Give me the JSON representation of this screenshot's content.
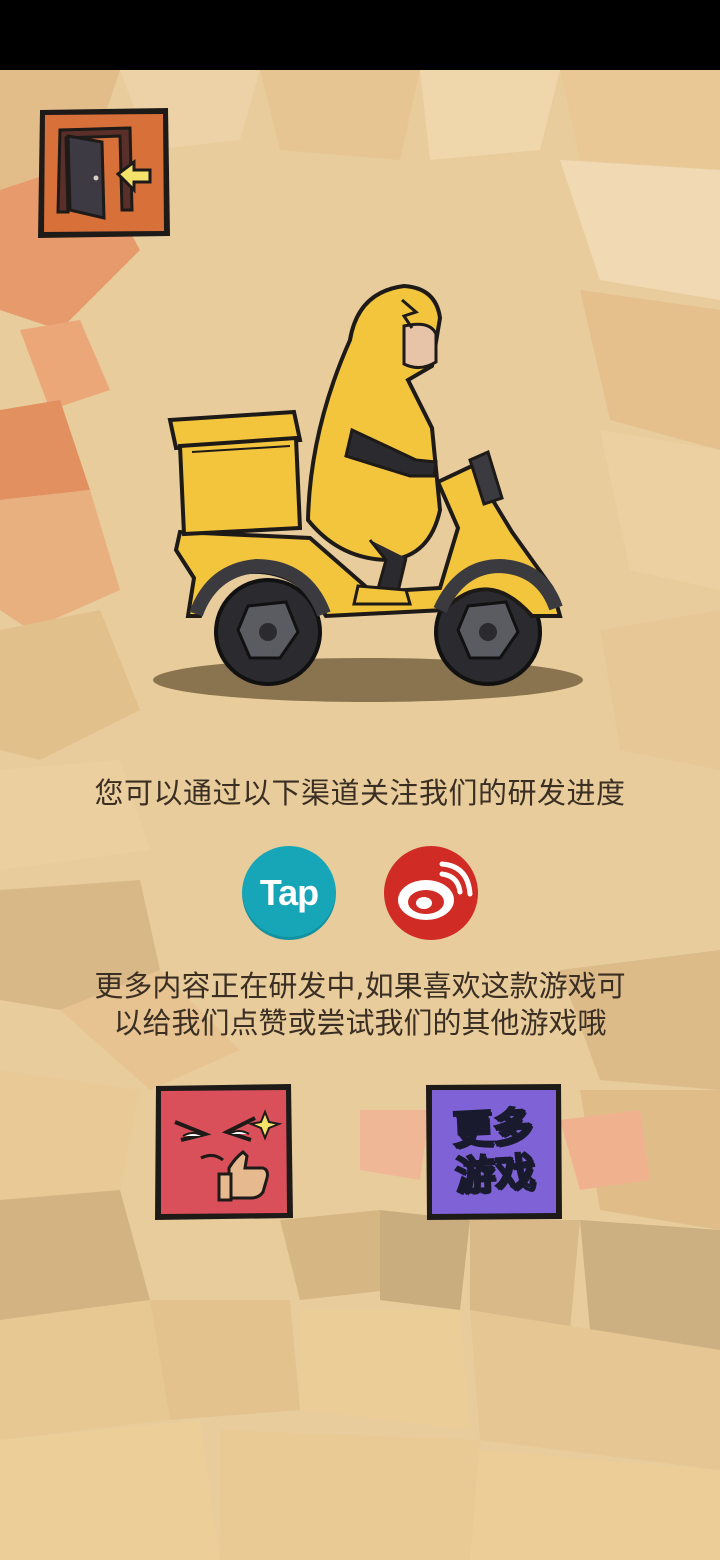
{
  "follow_prompt": "您可以通过以下渠道关注我们的研发进度",
  "social": {
    "tap_label": "Tap",
    "weibo_icon": "weibo-icon"
  },
  "more_content": {
    "line1": "更多内容正在研发中,如果喜欢这款游戏可",
    "line2": "以给我们点赞或尝试我们的其他游戏哦"
  },
  "buttons": {
    "exit_icon": "exit-door-icon",
    "like_icon": "thumbs-up-face-icon",
    "more_games_line1": "更多",
    "more_games_line2": "游戏"
  },
  "colors": {
    "background": "#e6c99a",
    "tap_brand": "#17a6b7",
    "weibo_brand": "#d12b25",
    "exit_tile": "#d8703a",
    "like_tile": "#d9505a",
    "more_games_tile": "#7e62d6",
    "courier_yellow": "#f2c53d"
  }
}
